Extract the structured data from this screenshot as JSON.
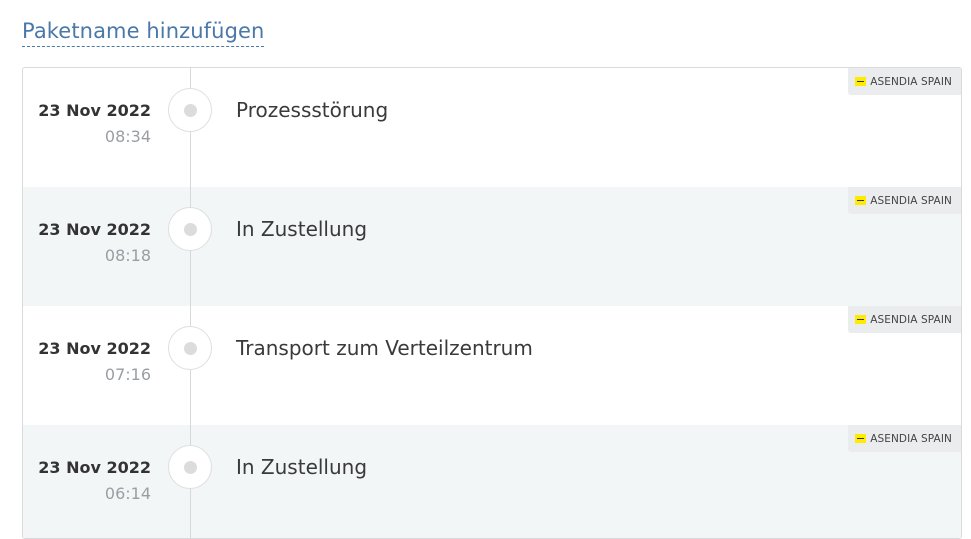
{
  "header": {
    "add_name_link": "Paketname hinzufügen"
  },
  "events": [
    {
      "date": "23 Nov 2022",
      "time": "08:34",
      "status": "Prozessstörung",
      "carrier": "ASENDIA SPAIN"
    },
    {
      "date": "23 Nov 2022",
      "time": "08:18",
      "status": "In Zustellung",
      "carrier": "ASENDIA SPAIN"
    },
    {
      "date": "23 Nov 2022",
      "time": "07:16",
      "status": "Transport zum Verteilzentrum",
      "carrier": "ASENDIA SPAIN"
    },
    {
      "date": "23 Nov 2022",
      "time": "06:14",
      "status": "In Zustellung",
      "carrier": "ASENDIA SPAIN"
    }
  ],
  "colors": {
    "link": "#4a78a8",
    "alt_row_background": "#f3f6f7",
    "carrier_logo": "#ffeb00"
  },
  "icons": {
    "timeline_dot": "timeline-dot-icon",
    "carrier_logo": "asendia-logo-icon"
  }
}
